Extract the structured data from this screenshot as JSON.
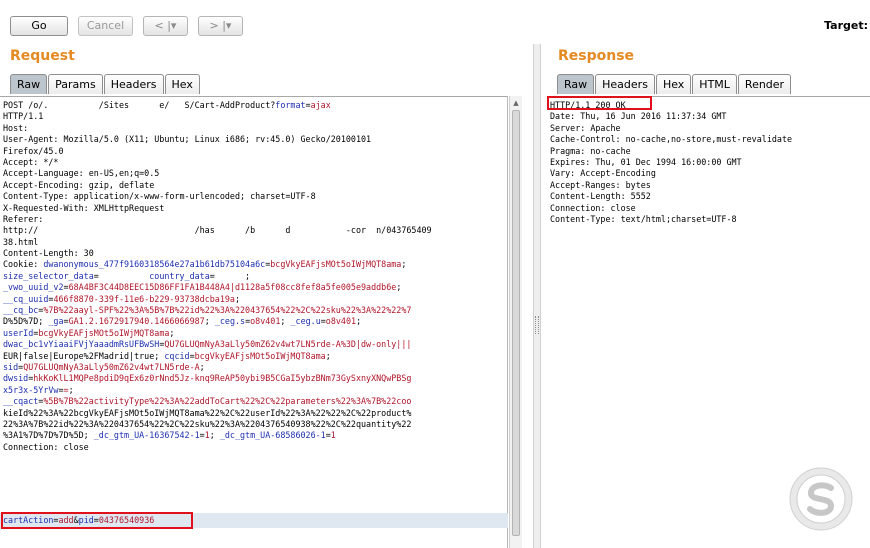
{
  "toolbar": {
    "go_label": "Go",
    "cancel_label": "Cancel",
    "back_label": "< |▾",
    "forward_label": "> |▾",
    "target_label": "Target:"
  },
  "request": {
    "heading": "Request",
    "tabs": [
      {
        "label": "Raw",
        "active": true
      },
      {
        "label": "Params",
        "active": false
      },
      {
        "label": "Headers",
        "active": false
      },
      {
        "label": "Hex",
        "active": false
      }
    ],
    "lines": [
      "POST /o/.          /Sites      e/   S/Cart-AddProduct?format=ajax",
      "HTTP/1.1",
      "Host: ",
      "User-Agent: Mozilla/5.0 (X11; Ubuntu; Linux i686; rv:45.0) Gecko/20100101",
      "Firefox/45.0",
      "Accept: */*",
      "Accept-Language: en-US,en;q=0.5",
      "Accept-Encoding: gzip, deflate",
      "Content-Type: application/x-www-form-urlencoded; charset=UTF-8",
      "X-Requested-With: XMLHttpRequest",
      "Referer:",
      "http://                               /has      /b      d           -cor  n/043765409",
      "38.html",
      "Content-Length: 30",
      "Cookie: dwanonymous_477f9160318564e27a1b61db75104a6c=bcgVkyEAFjsMOt5oIWjMQT8ama;",
      "size_selector_data=          country_data=      ;",
      "_vwo_uuid_v2=68A4BF3C44D8EEC15D86FF1FA1B448A4|d1128a5f08cc8fef8a5fe005e9addb6e;",
      "__cq_uuid=466f8870-339f-11e6-b229-93738dcba19a;",
      "__cq_bc=%7B%22aayl-SPF%22%3A%5B%7B%22id%22%3A%220437654%22%2C%22sku%22%3A%22%22%7",
      "D%5D%7D; _ga=GA1.2.1672917940.1466066987; _ceg.s=o8v401; _ceg.u=o8v401;",
      "userId=bcgVkyEAFjsMOt5oIWjMQT8ama;",
      "dwac_bc1vYiaaiFVjYaaadmRsUFBwSH=QU7GLUQmNyA3aLly50mZ62v4wt7LN5rde-A%3D|dw-only|||",
      "EUR|false|Europe%2FMadrid|true; cqcid=bcgVkyEAFjsMOt5oIWjMQT8ama;",
      "sid=QU7GLUQmNyA3aLly50mZ62v4wt7LN5rde-A;",
      "dwsid=hkKoKlL1MQPe8pdiD9qEx6z0rNnd5Jz-knq9ReAP50ybi9B5CGaI5ybzBNm73GySxnyXNQwPBSg",
      "x5r3x-5YrVw==;",
      "__cqact=%5B%7B%22activityType%22%3A%22addToCart%22%2C%22parameters%22%3A%7B%22coo",
      "kieId%22%3A%22bcgVkyEAFjsMOt5oIWjMQT8ama%22%2C%22userId%22%3A%22%22%2C%22product%",
      "22%3A%7B%22id%22%3A%220437654%22%2C%22sku%22%3A%2204376540938%22%2C%22quantity%22",
      "%3A1%7D%7D%7D%5D; _dc_gtm_UA-16367542-1=1; _dc_gtm_UA-68586026-1=1",
      "Connection: close",
      ""
    ],
    "body": {
      "key1": "cartAction",
      "val1": "add",
      "key2": "pid",
      "val2": "04376540936"
    }
  },
  "response": {
    "heading": "Response",
    "tabs": [
      {
        "label": "Raw",
        "active": true
      },
      {
        "label": "Headers",
        "active": false
      },
      {
        "label": "Hex",
        "active": false
      },
      {
        "label": "HTML",
        "active": false
      },
      {
        "label": "Render",
        "active": false
      }
    ],
    "lines": [
      "HTTP/1.1 200 OK",
      "Date: Thu, 16 Jun 2016 11:37:34 GMT",
      "Server: Apache",
      "Cache-Control: no-cache,no-store,must-revalidate",
      "Pragma: no-cache",
      "Expires: Thu, 01 Dec 1994 16:00:00 GMT",
      "Vary: Accept-Encoding",
      "Accept-Ranges: bytes",
      "Content-Length: 5552",
      "Connection: close",
      "Content-Type: text/html;charset=UTF-8"
    ]
  },
  "colors": {
    "heading": "#e58a22",
    "highlight": "#e0111b",
    "param_name": "#1d2fb0",
    "param_value": "#b0152a"
  },
  "icons": {
    "logo": "solvetic-logo"
  }
}
